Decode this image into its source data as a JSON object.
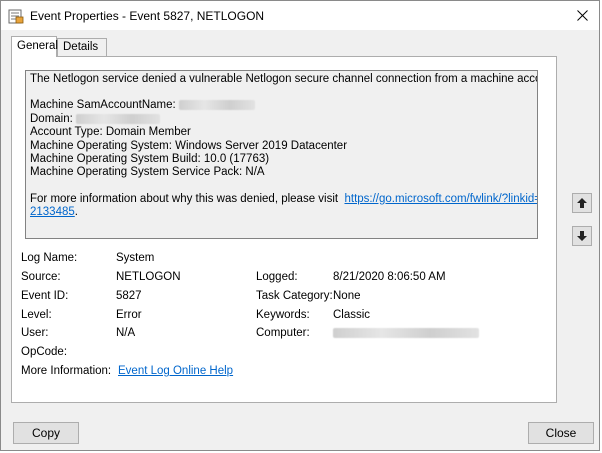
{
  "window": {
    "title": "Event Properties - Event 5827, NETLOGON",
    "close_symbol": "✕"
  },
  "tabs": [
    {
      "label": "General",
      "active": true
    },
    {
      "label": "Details",
      "active": false
    }
  ],
  "description": {
    "line1": "The Netlogon service denied a vulnerable Netlogon secure channel connection from a machine account.",
    "sam_label": "Machine SamAccountName:",
    "domain_label": "Domain:",
    "account_type": "Account Type: Domain Member",
    "os": "Machine Operating System: Windows Server 2019 Datacenter",
    "build": "Machine Operating System Build: 10.0 (17763)",
    "service_pack": "Machine Operating System Service Pack: N/A",
    "more_info_prefix": "For more information about why this was denied, please visit",
    "link_part1": "https://go.microsoft.com/fwlink/?linkid=",
    "link_part2": "2133485",
    "trailing": "."
  },
  "details": {
    "log_name_label": "Log Name:",
    "log_name": "System",
    "source_label": "Source:",
    "source": "NETLOGON",
    "event_id_label": "Event ID:",
    "event_id": "5827",
    "level_label": "Level:",
    "level": "Error",
    "user_label": "User:",
    "user": "N/A",
    "opcode_label": "OpCode:",
    "more_info_label": "More Information:",
    "more_info_link": "Event Log Online Help",
    "logged_label": "Logged:",
    "logged": "8/21/2020 8:06:50 AM",
    "task_category_label": "Task Category:",
    "task_category": "None",
    "keywords_label": "Keywords:",
    "keywords": "Classic",
    "computer_label": "Computer:"
  },
  "buttons": {
    "copy": "Copy",
    "close": "Close"
  },
  "icons": {
    "app": "event-viewer-icon",
    "up": "arrow-up-icon",
    "down": "arrow-down-icon",
    "close": "close-icon"
  },
  "colors": {
    "link": "#0066cc",
    "window_bg": "#f0f0f0"
  }
}
